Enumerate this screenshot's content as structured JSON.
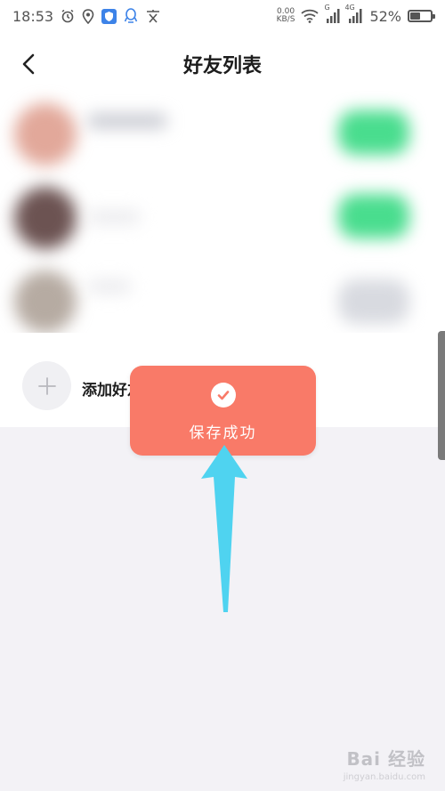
{
  "status_bar": {
    "time": "18:53",
    "net_speed_value": "0.00",
    "net_speed_unit": "KB/S",
    "signal_1_label": "G",
    "signal_2_label": "4G",
    "battery_percent": "52%",
    "battery_level": 0.52,
    "icons": [
      "alarm-icon",
      "location-icon",
      "shield-icon",
      "qq-icon",
      "translate-icon",
      "wifi-icon",
      "signal-icon",
      "battery-icon"
    ]
  },
  "header": {
    "title": "好友列表",
    "back_icon": "chevron-left-icon"
  },
  "friends": {
    "rows": [
      {
        "avatar_color": "#e2a89a",
        "name_color": "#c6c8d0",
        "action_color": "#49dd8e"
      },
      {
        "avatar_color": "#6c5352",
        "name_color": "#ebebee",
        "action_color": "#49dd8e"
      },
      {
        "avatar_color": "#b6aba2",
        "name_color": "#ebebee",
        "action_color": "#d8dae0"
      }
    ]
  },
  "add_friend": {
    "label": "添加好友",
    "icon": "plus-icon"
  },
  "toast": {
    "text": "保存成功",
    "icon": "check-icon",
    "color": "#f97a68"
  },
  "annotation": {
    "arrow_color": "#4fd3f0"
  },
  "watermark": {
    "text": "Bai 经验",
    "subtext": "jingyan.baidu.com"
  }
}
